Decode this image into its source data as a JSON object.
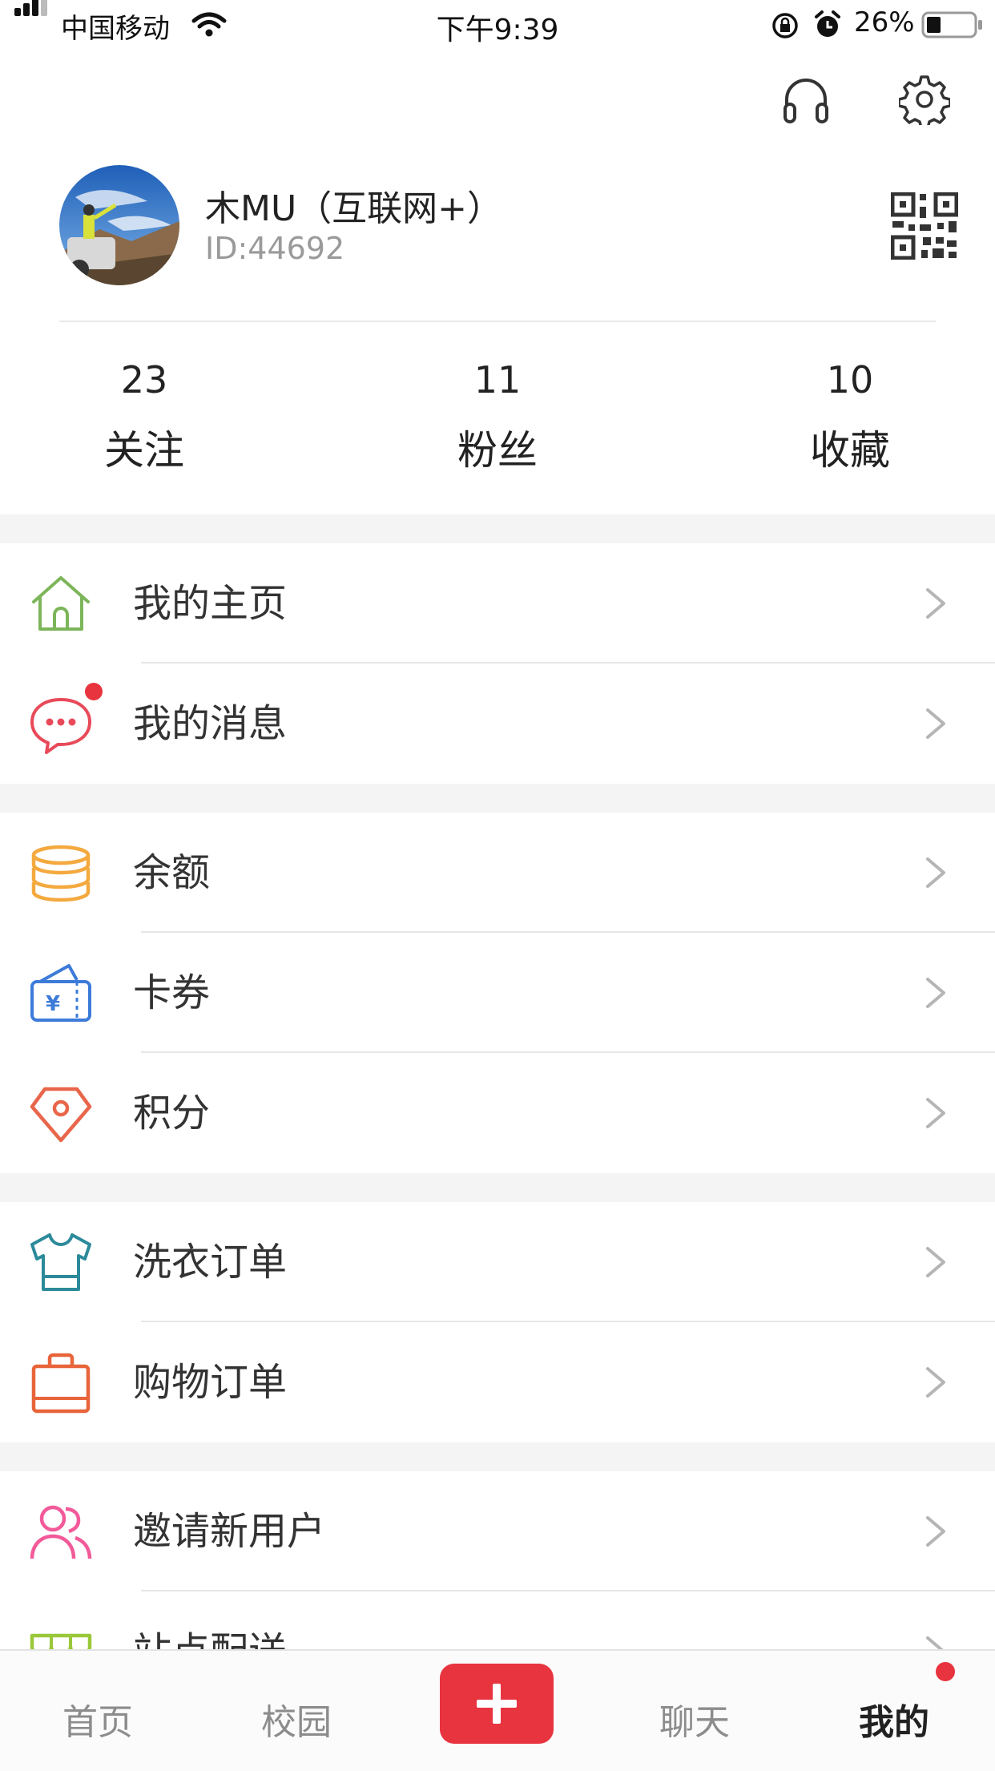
{
  "status_bar": {
    "carrier": "中国移动",
    "time": "下午9:39",
    "battery_percent": "26%"
  },
  "header": {
    "icons": [
      "headset-icon",
      "gear-icon"
    ]
  },
  "profile": {
    "username": "木MU（互联网+）",
    "user_id": "ID:44692"
  },
  "stats": [
    {
      "value": "23",
      "label": "关注"
    },
    {
      "value": "11",
      "label": "粉丝"
    },
    {
      "value": "10",
      "label": "收藏"
    }
  ],
  "menu": {
    "home": "我的主页",
    "messages": "我的消息",
    "balance": "余额",
    "coupons": "卡券",
    "points": "积分",
    "laundry_orders": "洗衣订单",
    "shopping_orders": "购物订单",
    "invite": "邀请新用户",
    "delivery": "站点配送"
  },
  "tabbar": {
    "home": "首页",
    "campus": "校园",
    "chat": "聊天",
    "mine": "我的"
  },
  "colors": {
    "accent": "#e8343f",
    "home_icon": "#7cb55a",
    "message_icon": "#e84a5a",
    "balance_icon": "#f4a93f",
    "coupon_icon": "#3d7bd9",
    "points_icon": "#e8664a",
    "laundry_icon": "#2c8a9a",
    "shopping_icon": "#e8643a",
    "invite_icon": "#f25a9a",
    "delivery_icon": "#9ac83a"
  }
}
